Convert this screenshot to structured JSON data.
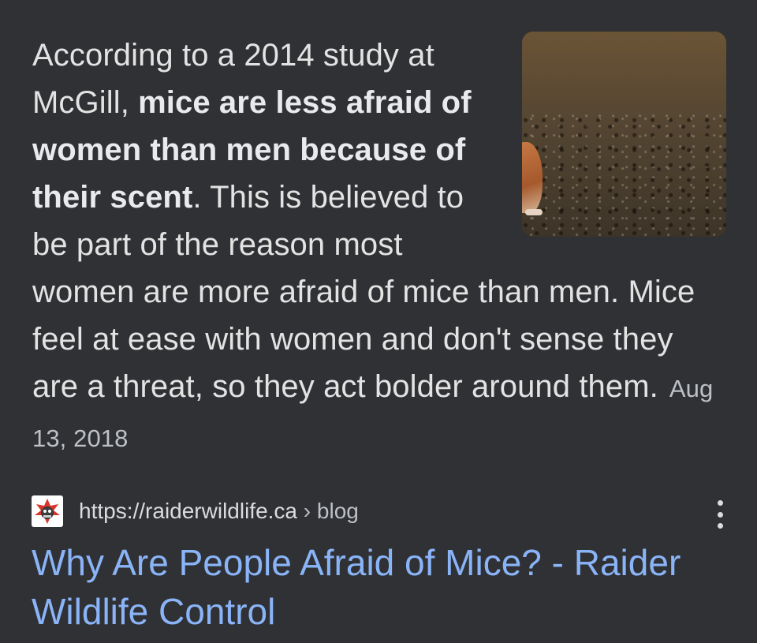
{
  "snippet": {
    "part1": "According to a 2014 study at McGill, ",
    "bold": "mice are less afraid of women than men because of their scent",
    "part2": ". This is believed to be part of the reason most women are more afraid of mice than men. Mice feel at ease with women and don't sense they are a threat, so they act bolder around them.",
    "date": "Aug 13, 2018",
    "thumbnail_icon": "mouse-photo-thumbnail"
  },
  "result": {
    "favicon_icon": "raider-wildlife-logo-icon",
    "url": "https://raiderwildlife.ca",
    "breadcrumb": " › blog",
    "more_icon": "more-vert-icon",
    "title": "Why Are People Afraid of Mice? - Raider Wildlife Control"
  },
  "colors": {
    "background": "#303134",
    "text": "#e3e3e3",
    "link": "#8ab4f8",
    "muted": "#bdc1c6"
  }
}
